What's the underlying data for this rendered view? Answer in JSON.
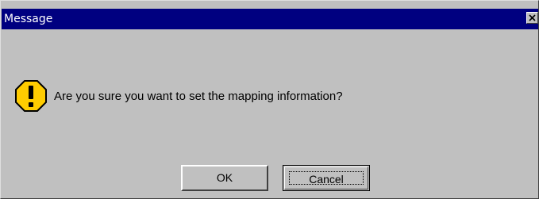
{
  "window": {
    "title": "Message"
  },
  "message": {
    "icon": "warning-icon",
    "text": "Are you sure you want to set the mapping information?"
  },
  "buttons": {
    "ok_label": "OK",
    "cancel_label": "Cancel"
  },
  "colors": {
    "titlebar": "#000080",
    "dialog_bg": "#c0c0c0",
    "icon_fill": "#ffcc00"
  }
}
